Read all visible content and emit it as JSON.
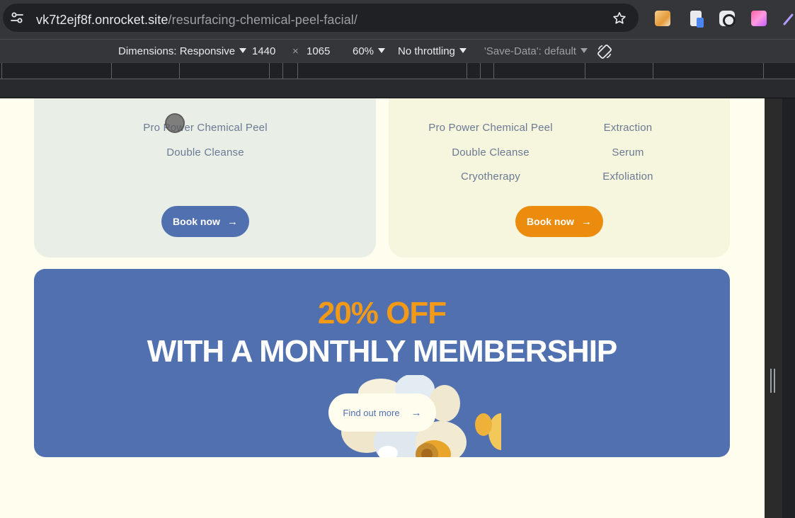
{
  "browser": {
    "url_host": "vk7t2ejf8f.onrocket.site",
    "url_path": "/resurfacing-chemical-peel-facial/"
  },
  "devtools": {
    "dimensions_label": "Dimensions: Responsive",
    "width": "1440",
    "times": "×",
    "height": "1065",
    "zoom": "60%",
    "throttling": "No throttling",
    "save_data": "'Save-Data': default"
  },
  "cards": {
    "left": {
      "features": [
        "Pro Power Chemical Peel",
        "Double Cleanse"
      ],
      "book_label": "Book now"
    },
    "right": {
      "features_col1": [
        "Pro Power Chemical Peel",
        "Double Cleanse",
        "Cryotherapy"
      ],
      "features_col2": [
        "Extraction",
        "Serum",
        "Exfoliation"
      ],
      "book_label": "Book now"
    }
  },
  "promo": {
    "line1": "20% OFF",
    "line2": "WITH A MONTHLY MEMBERSHIP",
    "button_label": "Find out more"
  },
  "colors": {
    "brand_blue": "#5170b0",
    "brand_orange": "#ec8c0f",
    "cream": "#fffdee"
  }
}
